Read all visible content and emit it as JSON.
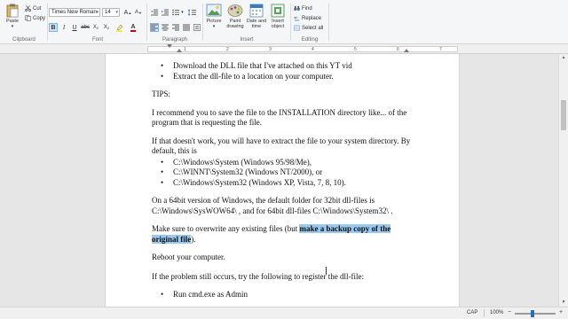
{
  "ribbon": {
    "clipboard": {
      "paste_label": "Paste",
      "cut_label": "Cut",
      "copy_label": "Copy",
      "group_label": "Clipboard"
    },
    "font": {
      "family": "Times New Roman",
      "size": "14",
      "group_label": "Font"
    },
    "paragraph": {
      "group_label": "Paragraph"
    },
    "insert": {
      "picture_label": "Picture",
      "paint_label": "Paint drawing",
      "datetime_label": "Date and time",
      "object_label": "Insert object",
      "group_label": "Insert"
    },
    "editing": {
      "find_label": "Find",
      "replace_label": "Replace",
      "select_all_label": "Select all",
      "group_label": "Editing"
    }
  },
  "ruler": {
    "numbers": [
      "1",
      "2",
      "3",
      "4",
      "5",
      "6",
      "7"
    ]
  },
  "document": {
    "bullets1": [
      "Download the DLL file that I've attached on this YT vid",
      "Extract the dll-file to a location on your computer."
    ],
    "tips": "TIPS:",
    "p1": "I recommend you to save the file to the INSTALLATION directory like... of the program that is requesting the file.",
    "p2": "If that doesn't work, you will have to extract the file to your system directory. By default, this is",
    "bullets2": [
      "C:\\Windows\\System (Windows 95/98/Me),",
      "C:\\WINNT\\System32 (Windows NT/2000), or",
      "C:\\Windows\\System32 (Windows XP, Vista, 7, 8, 10)."
    ],
    "p3": "On a 64bit version of Windows, the default folder for 32bit dll-files is C:\\Windows\\SysWOW64\\ , and for 64bit dll-files C:\\Windows\\System32\\ .",
    "p4_before": "Make sure to overwrite any existing files (but ",
    "p4_highlight": "make a backup copy of the original file",
    "p4_after": ").",
    "p5": "Reboot your computer.",
    "p6": "If the problem still occurs, try the following to register the dll-file:",
    "bullets3": [
      "Run cmd.exe as Admin"
    ]
  },
  "status": {
    "caps": "CAP",
    "zoom": "100%",
    "zoom_out": "−",
    "zoom_in": "+"
  },
  "colors": {
    "highlight": "#99c9ef",
    "accent": "#1f6fc5"
  }
}
